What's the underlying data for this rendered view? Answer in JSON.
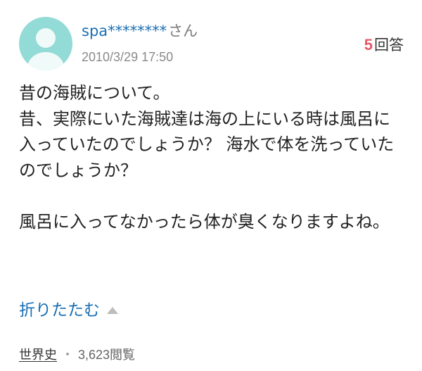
{
  "header": {
    "username": "spa********",
    "honorific": "さん",
    "date": "2010/3/29 17:50",
    "answer_count": "5",
    "answer_label": "回答"
  },
  "question": {
    "title": "昔の海賊について。",
    "body_lines": [
      "昔、実際にいた海賊達は海の上にいる時は風呂に入っていたのでしょうか？ 海水で体を洗っていたのでしょうか？",
      "",
      "風呂に入ってなかったら体が臭くなりますよね。"
    ]
  },
  "fold_toggle": {
    "label": "折りたたむ",
    "icon": "triangle-up-icon"
  },
  "footer": {
    "category": "世界史",
    "separator": "・",
    "views": "3,623",
    "views_label": "閲覧"
  },
  "colors": {
    "avatar_bg": "#93dbd6",
    "link_blue": "#1a6fb3",
    "answer_count_red": "#e45a6b"
  }
}
